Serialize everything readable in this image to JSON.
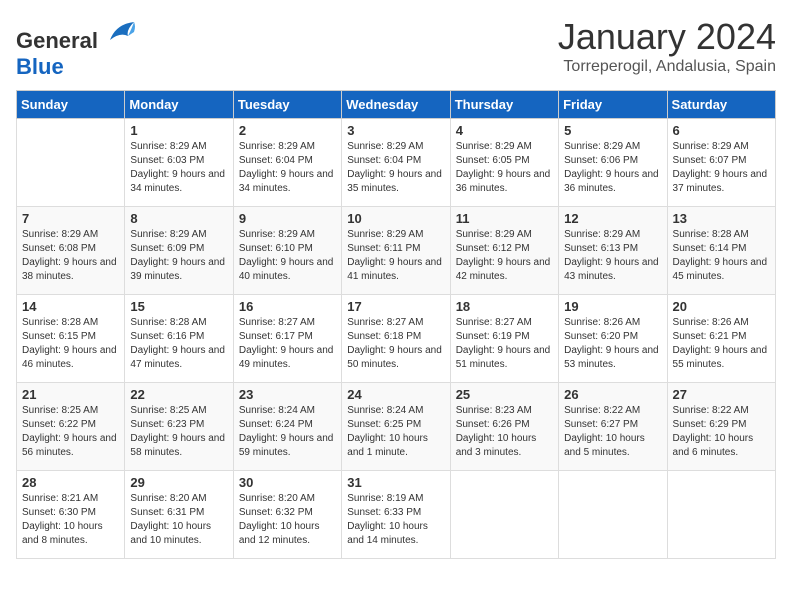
{
  "header": {
    "logo_general": "General",
    "logo_blue": "Blue",
    "month_year": "January 2024",
    "location": "Torreperogil, Andalusia, Spain"
  },
  "weekdays": [
    "Sunday",
    "Monday",
    "Tuesday",
    "Wednesday",
    "Thursday",
    "Friday",
    "Saturday"
  ],
  "weeks": [
    [
      {
        "day": "",
        "sunrise": "",
        "sunset": "",
        "daylight": ""
      },
      {
        "day": "1",
        "sunrise": "Sunrise: 8:29 AM",
        "sunset": "Sunset: 6:03 PM",
        "daylight": "Daylight: 9 hours and 34 minutes."
      },
      {
        "day": "2",
        "sunrise": "Sunrise: 8:29 AM",
        "sunset": "Sunset: 6:04 PM",
        "daylight": "Daylight: 9 hours and 34 minutes."
      },
      {
        "day": "3",
        "sunrise": "Sunrise: 8:29 AM",
        "sunset": "Sunset: 6:04 PM",
        "daylight": "Daylight: 9 hours and 35 minutes."
      },
      {
        "day": "4",
        "sunrise": "Sunrise: 8:29 AM",
        "sunset": "Sunset: 6:05 PM",
        "daylight": "Daylight: 9 hours and 36 minutes."
      },
      {
        "day": "5",
        "sunrise": "Sunrise: 8:29 AM",
        "sunset": "Sunset: 6:06 PM",
        "daylight": "Daylight: 9 hours and 36 minutes."
      },
      {
        "day": "6",
        "sunrise": "Sunrise: 8:29 AM",
        "sunset": "Sunset: 6:07 PM",
        "daylight": "Daylight: 9 hours and 37 minutes."
      }
    ],
    [
      {
        "day": "7",
        "sunrise": "Sunrise: 8:29 AM",
        "sunset": "Sunset: 6:08 PM",
        "daylight": "Daylight: 9 hours and 38 minutes."
      },
      {
        "day": "8",
        "sunrise": "Sunrise: 8:29 AM",
        "sunset": "Sunset: 6:09 PM",
        "daylight": "Daylight: 9 hours and 39 minutes."
      },
      {
        "day": "9",
        "sunrise": "Sunrise: 8:29 AM",
        "sunset": "Sunset: 6:10 PM",
        "daylight": "Daylight: 9 hours and 40 minutes."
      },
      {
        "day": "10",
        "sunrise": "Sunrise: 8:29 AM",
        "sunset": "Sunset: 6:11 PM",
        "daylight": "Daylight: 9 hours and 41 minutes."
      },
      {
        "day": "11",
        "sunrise": "Sunrise: 8:29 AM",
        "sunset": "Sunset: 6:12 PM",
        "daylight": "Daylight: 9 hours and 42 minutes."
      },
      {
        "day": "12",
        "sunrise": "Sunrise: 8:29 AM",
        "sunset": "Sunset: 6:13 PM",
        "daylight": "Daylight: 9 hours and 43 minutes."
      },
      {
        "day": "13",
        "sunrise": "Sunrise: 8:28 AM",
        "sunset": "Sunset: 6:14 PM",
        "daylight": "Daylight: 9 hours and 45 minutes."
      }
    ],
    [
      {
        "day": "14",
        "sunrise": "Sunrise: 8:28 AM",
        "sunset": "Sunset: 6:15 PM",
        "daylight": "Daylight: 9 hours and 46 minutes."
      },
      {
        "day": "15",
        "sunrise": "Sunrise: 8:28 AM",
        "sunset": "Sunset: 6:16 PM",
        "daylight": "Daylight: 9 hours and 47 minutes."
      },
      {
        "day": "16",
        "sunrise": "Sunrise: 8:27 AM",
        "sunset": "Sunset: 6:17 PM",
        "daylight": "Daylight: 9 hours and 49 minutes."
      },
      {
        "day": "17",
        "sunrise": "Sunrise: 8:27 AM",
        "sunset": "Sunset: 6:18 PM",
        "daylight": "Daylight: 9 hours and 50 minutes."
      },
      {
        "day": "18",
        "sunrise": "Sunrise: 8:27 AM",
        "sunset": "Sunset: 6:19 PM",
        "daylight": "Daylight: 9 hours and 51 minutes."
      },
      {
        "day": "19",
        "sunrise": "Sunrise: 8:26 AM",
        "sunset": "Sunset: 6:20 PM",
        "daylight": "Daylight: 9 hours and 53 minutes."
      },
      {
        "day": "20",
        "sunrise": "Sunrise: 8:26 AM",
        "sunset": "Sunset: 6:21 PM",
        "daylight": "Daylight: 9 hours and 55 minutes."
      }
    ],
    [
      {
        "day": "21",
        "sunrise": "Sunrise: 8:25 AM",
        "sunset": "Sunset: 6:22 PM",
        "daylight": "Daylight: 9 hours and 56 minutes."
      },
      {
        "day": "22",
        "sunrise": "Sunrise: 8:25 AM",
        "sunset": "Sunset: 6:23 PM",
        "daylight": "Daylight: 9 hours and 58 minutes."
      },
      {
        "day": "23",
        "sunrise": "Sunrise: 8:24 AM",
        "sunset": "Sunset: 6:24 PM",
        "daylight": "Daylight: 9 hours and 59 minutes."
      },
      {
        "day": "24",
        "sunrise": "Sunrise: 8:24 AM",
        "sunset": "Sunset: 6:25 PM",
        "daylight": "Daylight: 10 hours and 1 minute."
      },
      {
        "day": "25",
        "sunrise": "Sunrise: 8:23 AM",
        "sunset": "Sunset: 6:26 PM",
        "daylight": "Daylight: 10 hours and 3 minutes."
      },
      {
        "day": "26",
        "sunrise": "Sunrise: 8:22 AM",
        "sunset": "Sunset: 6:27 PM",
        "daylight": "Daylight: 10 hours and 5 minutes."
      },
      {
        "day": "27",
        "sunrise": "Sunrise: 8:22 AM",
        "sunset": "Sunset: 6:29 PM",
        "daylight": "Daylight: 10 hours and 6 minutes."
      }
    ],
    [
      {
        "day": "28",
        "sunrise": "Sunrise: 8:21 AM",
        "sunset": "Sunset: 6:30 PM",
        "daylight": "Daylight: 10 hours and 8 minutes."
      },
      {
        "day": "29",
        "sunrise": "Sunrise: 8:20 AM",
        "sunset": "Sunset: 6:31 PM",
        "daylight": "Daylight: 10 hours and 10 minutes."
      },
      {
        "day": "30",
        "sunrise": "Sunrise: 8:20 AM",
        "sunset": "Sunset: 6:32 PM",
        "daylight": "Daylight: 10 hours and 12 minutes."
      },
      {
        "day": "31",
        "sunrise": "Sunrise: 8:19 AM",
        "sunset": "Sunset: 6:33 PM",
        "daylight": "Daylight: 10 hours and 14 minutes."
      },
      {
        "day": "",
        "sunrise": "",
        "sunset": "",
        "daylight": ""
      },
      {
        "day": "",
        "sunrise": "",
        "sunset": "",
        "daylight": ""
      },
      {
        "day": "",
        "sunrise": "",
        "sunset": "",
        "daylight": ""
      }
    ]
  ]
}
